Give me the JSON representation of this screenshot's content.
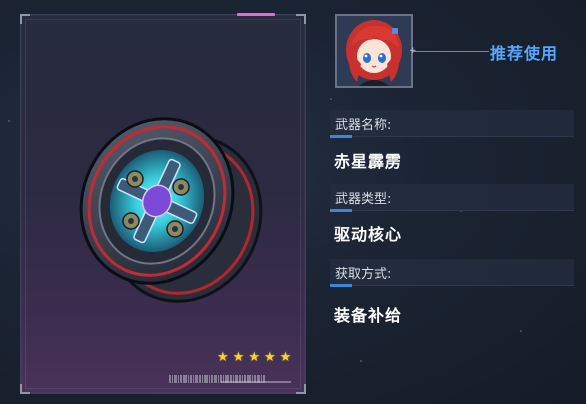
{
  "weapon_card": {
    "rarity_stars": 5,
    "rarity_star_glyph": "★",
    "accent_color": "#e26ad3",
    "star_color": "#f7d23c"
  },
  "recommend": {
    "label": "推荐使用",
    "color": "#58a6ff"
  },
  "info": {
    "name_label": "武器名称:",
    "name_value": "赤星霹雳",
    "type_label": "武器类型:",
    "type_value": "驱动核心",
    "source_label": "获取方式:",
    "source_value": "装备补给",
    "accent_color": "#3f86d8"
  }
}
